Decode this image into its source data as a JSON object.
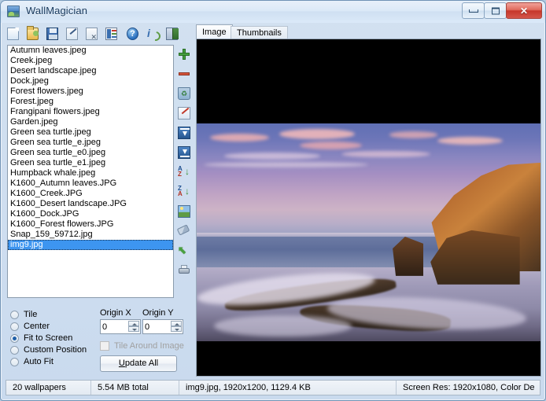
{
  "window": {
    "title": "WallMagician",
    "app_icon": "picture-icon",
    "minimize_label": "Minimize",
    "maximize_label": "Maximize",
    "close_label": "Close"
  },
  "toolbar": {
    "items": [
      {
        "name": "new",
        "icon": "new-document-icon",
        "tooltip": "New"
      },
      {
        "name": "open",
        "icon": "open-folder-icon",
        "tooltip": "Open"
      },
      {
        "name": "save",
        "icon": "save-disk-icon",
        "tooltip": "Save"
      },
      {
        "name": "edit",
        "icon": "edit-pencil-icon",
        "tooltip": "Edit"
      },
      {
        "name": "delete",
        "icon": "delete-document-icon",
        "tooltip": "Delete"
      },
      {
        "name": "properties",
        "icon": "properties-icon",
        "tooltip": "Properties"
      },
      {
        "name": "help",
        "icon": "help-question-icon",
        "tooltip": "Help"
      },
      {
        "name": "about",
        "icon": "about-info-icon",
        "tooltip": "About"
      },
      {
        "name": "exit",
        "icon": "exit-door-icon",
        "tooltip": "Exit"
      }
    ]
  },
  "side_toolbar": {
    "items": [
      {
        "name": "add",
        "icon": "plus-icon",
        "tooltip": "Add"
      },
      {
        "name": "remove",
        "icon": "minus-icon",
        "tooltip": "Remove"
      },
      {
        "name": "clear",
        "icon": "recycle-bin-icon",
        "tooltip": "Clear list"
      },
      {
        "name": "rename",
        "icon": "pen-icon",
        "tooltip": "Rename"
      },
      {
        "name": "move-top",
        "icon": "move-to-top-icon",
        "tooltip": "Move to top"
      },
      {
        "name": "move-bottom",
        "icon": "move-to-bottom-icon",
        "tooltip": "Move to bottom"
      },
      {
        "name": "sort-asc",
        "icon": "sort-az-icon",
        "tooltip": "Sort A-Z",
        "top": "A",
        "bottom": "Z"
      },
      {
        "name": "sort-desc",
        "icon": "sort-za-icon",
        "tooltip": "Sort Z-A",
        "top": "Z",
        "bottom": "A"
      },
      {
        "name": "preview",
        "icon": "image-preview-icon",
        "tooltip": "Preview"
      },
      {
        "name": "eraser",
        "icon": "eraser-icon",
        "tooltip": "Erase"
      },
      {
        "name": "undo",
        "icon": "undo-arrow-icon",
        "tooltip": "Undo"
      },
      {
        "name": "print",
        "icon": "printer-icon",
        "tooltip": "Print"
      }
    ]
  },
  "file_list": {
    "selected_index": 19,
    "items": [
      "Autumn leaves.jpeg",
      "Creek.jpeg",
      "Desert landscape.jpeg",
      "Dock.jpeg",
      "Forest flowers.jpeg",
      "Forest.jpeg",
      "Frangipani flowers.jpeg",
      "Garden.jpeg",
      "Green sea turtle.jpeg",
      "Green sea turtle_e.jpeg",
      "Green sea turtle_e0.jpeg",
      "Green sea turtle_e1.jpeg",
      "Humpback whale.jpeg",
      "K1600_Autumn leaves.JPG",
      "K1600_Creek.JPG",
      "K1600_Desert landscape.JPG",
      "K1600_Dock.JPG",
      "K1600_Forest flowers.JPG",
      "Snap_159_59712.jpg",
      "img9.jpg"
    ]
  },
  "options": {
    "mode_selected": "Fit to Screen",
    "modes": [
      "Tile",
      "Center",
      "Fit to Screen",
      "Custom Position",
      "Auto Fit"
    ],
    "origin_x": {
      "label": "Origin X",
      "value": "0"
    },
    "origin_y": {
      "label": "Origin Y",
      "value": "0"
    },
    "tile_around": {
      "label": "Tile Around Image",
      "checked": false,
      "enabled": false
    },
    "update_button": {
      "accel": "U",
      "rest": "pdate All"
    }
  },
  "preview": {
    "tabs": [
      {
        "label": "Image",
        "active": true
      },
      {
        "label": "Thumbnails",
        "active": false
      }
    ],
    "image_description": "Coastal sunset seascape with rocky cliffs and breaking waves, letterboxed on black"
  },
  "status": {
    "count": "20 wallpapers",
    "total_size": "5.54 MB total",
    "file_info": "img9.jpg, 1920x1200, 1129.4 KB",
    "screen_info": "Screen Res: 1920x1080, Color De"
  },
  "colors": {
    "selection": "#3d95f0",
    "window_frame": "#6f92b5",
    "title_text": "#16385c",
    "close_button": "#c6362a"
  }
}
